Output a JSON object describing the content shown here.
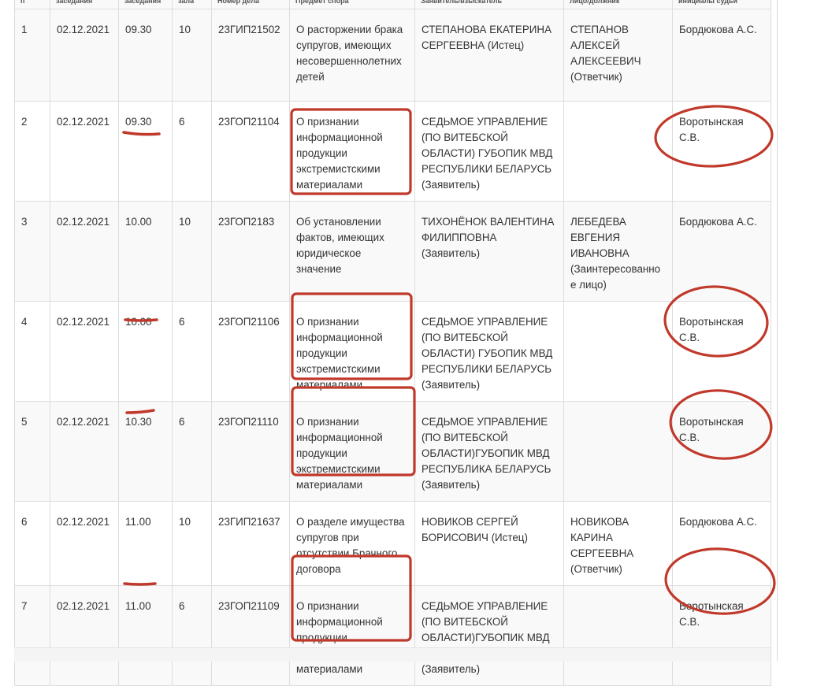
{
  "columns": [
    "п",
    "заседания",
    "заседания",
    "зала",
    "Номер дела",
    "Предмет спора",
    "Заявитель/взыскатель",
    "лицо/должник",
    "инициалы судьи"
  ],
  "rows": [
    {
      "num": "1",
      "date": "02.12.2021",
      "time": "09.30",
      "hall": "10",
      "case": "23ГИП21502",
      "subject": "О расторжении брака супругов, имеющих несовершеннолетних детей",
      "applicant": "СТЕПАНОВА ЕКАТЕРИНА СЕРГЕЕВНА (Истец)",
      "debtor": "СТЕПАНОВ АЛЕКСЕЙ АЛЕКСЕЕВИЧ (Ответчик)",
      "judge": "Бордюкова А.С."
    },
    {
      "num": "2",
      "date": "02.12.2021",
      "time": "09.30",
      "hall": "6",
      "case": "23ГОП21104",
      "subject": "О признании информационной продукции экстремистскими материалами",
      "applicant": "СЕДЬМОЕ УПРАВЛЕНИЕ (ПО ВИТЕБСКОЙ ОБЛАСТИ) ГУБОПИК МВД РЕСПУБЛИКИ БЕЛАРУСЬ (Заявитель)",
      "debtor": "",
      "judge": "Воротынская С.В."
    },
    {
      "num": "3",
      "date": "02.12.2021",
      "time": "10.00",
      "hall": "10",
      "case": "23ГОП2183",
      "subject": "Об установлении фактов, имеющих юридическое значение",
      "applicant": "ТИХОНЁНОК ВАЛЕНТИНА ФИЛИППОВНА (Заявитель)",
      "debtor": "ЛЕБЕДЕВА ЕВГЕНИЯ ИВАНОВНА (Заинтересованное лицо)",
      "judge": "Бордюкова А.С."
    },
    {
      "num": "4",
      "date": "02.12.2021",
      "time": "10.00",
      "hall": "6",
      "case": "23ГОП21106",
      "subject": "О признании информационной продукции экстремистскими материалами",
      "applicant": "СЕДЬМОЕ УПРАВЛЕНИЕ (ПО ВИТЕБСКОЙ ОБЛАСТИ) ГУБОПИК МВД РЕСПУБЛИКИ БЕЛАРУСЬ (Заявитель)",
      "debtor": "",
      "judge": "Воротынская С.В."
    },
    {
      "num": "5",
      "date": "02.12.2021",
      "time": "10.30",
      "hall": "6",
      "case": "23ГОП21110",
      "subject": "О признании информационной продукции экстремистскими материалами",
      "applicant": "СЕДЬМОЕ УПРАВЛЕНИЕ (ПО ВИТЕБСКОЙ ОБЛАСТИ)ГУБОПИК МВД РЕСПУБЛИКА БЕЛАРУСЬ (Заявитель)",
      "debtor": "",
      "judge": "Воротынская С.В."
    },
    {
      "num": "6",
      "date": "02.12.2021",
      "time": "11.00",
      "hall": "10",
      "case": "23ГИП21637",
      "subject": "О разделе имущества супругов при отсутствии Брачного договора",
      "applicant": "НОВИКОВ СЕРГЕЙ БОРИСОВИЧ (Истец)",
      "debtor": "НОВИКОВА КАРИНА СЕРГЕЕВНА (Ответчик)",
      "judge": "Бордюкова А.С."
    },
    {
      "num": "7",
      "date": "02.12.2021",
      "time": "11.00",
      "hall": "6",
      "case": "23ГОП21109",
      "subject": "О признании информационной продукции экстремистскими материалами",
      "applicant": "СЕДЬМОЕ УПРАВЛЕНИЕ (ПО ВИТЕБСКОЙ ОБЛАСТИ)ГУБОПИК МВД РЕСПУБЛИКА БЕЛАРУСЬ (Заявитель)",
      "debtor": "",
      "judge": "Воротынская С.В."
    }
  ],
  "annotation_color": "#c0392b"
}
